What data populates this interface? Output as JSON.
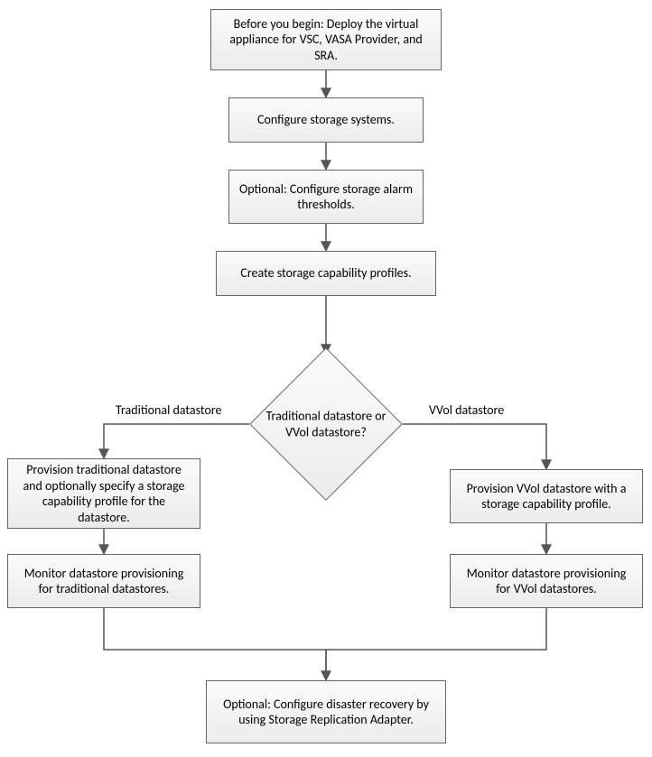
{
  "chart_data": {
    "type": "flowchart",
    "nodes": [
      {
        "id": "n1",
        "type": "process",
        "text": "Before you begin: Deploy the virtual appliance for VSC, VASA Provider, and SRA."
      },
      {
        "id": "n2",
        "type": "process",
        "text": "Configure storage systems."
      },
      {
        "id": "n3",
        "type": "process",
        "text": "Optional: Configure storage alarm thresholds."
      },
      {
        "id": "n4",
        "type": "process",
        "text": "Create storage capability profiles."
      },
      {
        "id": "d1",
        "type": "decision",
        "text": "Traditional datastore or VVol datastore?"
      },
      {
        "id": "l1",
        "type": "process",
        "text": "Provision traditional datastore and optionally specify a storage capability profile for the datastore."
      },
      {
        "id": "l2",
        "type": "process",
        "text": "Monitor datastore provisioning for traditional datastores."
      },
      {
        "id": "r1",
        "type": "process",
        "text": "Provision VVol datastore with a storage capability profile."
      },
      {
        "id": "r2",
        "type": "process",
        "text": "Monitor datastore provisioning for VVol datastores."
      },
      {
        "id": "n5",
        "type": "process",
        "text": "Optional: Configure disaster recovery by using Storage Replication Adapter."
      }
    ],
    "edges": [
      {
        "from": "n1",
        "to": "n2"
      },
      {
        "from": "n2",
        "to": "n3"
      },
      {
        "from": "n3",
        "to": "n4"
      },
      {
        "from": "n4",
        "to": "d1"
      },
      {
        "from": "d1",
        "to": "l1",
        "label": "Traditional datastore"
      },
      {
        "from": "d1",
        "to": "r1",
        "label": "VVol datastore"
      },
      {
        "from": "l1",
        "to": "l2"
      },
      {
        "from": "r1",
        "to": "r2"
      },
      {
        "from": "l2",
        "to": "n5"
      },
      {
        "from": "r2",
        "to": "n5"
      }
    ]
  },
  "labels": {
    "left": "Traditional datastore",
    "right": "VVol datastore"
  }
}
